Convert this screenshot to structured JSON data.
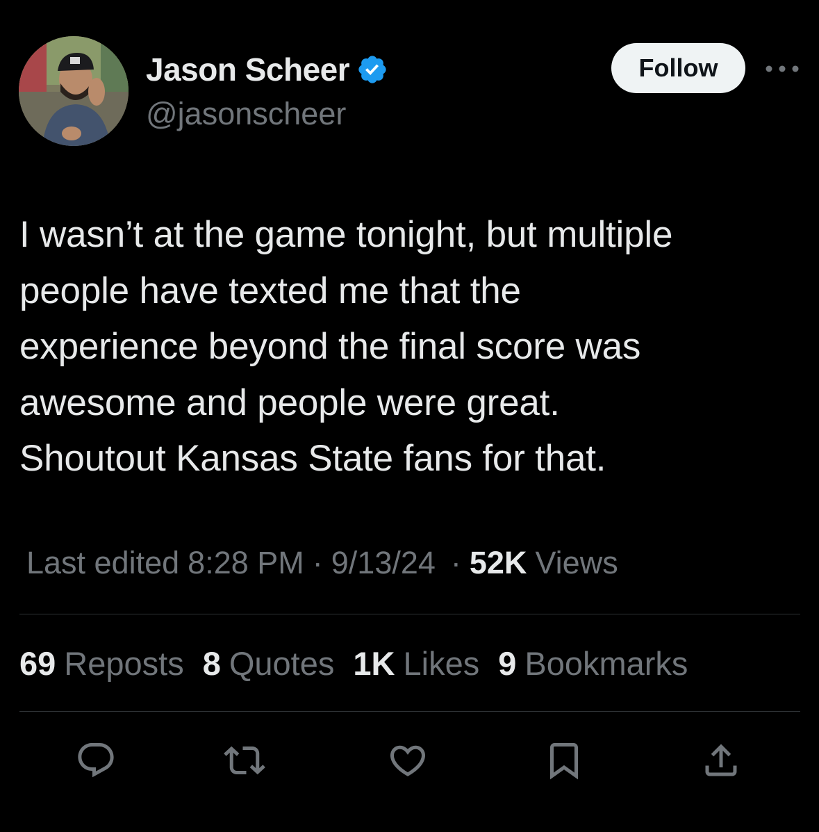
{
  "user": {
    "display_name": "Jason Scheer",
    "handle": "@jasonscheer",
    "verified": true,
    "avatar_icon": "profile-photo"
  },
  "header": {
    "follow_label": "Follow",
    "more_icon": "more-dots-icon"
  },
  "tweet": {
    "text": "I wasn’t at the game tonight, but multiple\npeople have texted me that the\nexperience beyond the final score was\nawesome and people were great.\nShoutout Kansas State fans for that."
  },
  "meta": {
    "edited_label": "Last edited",
    "time": "8:28 PM",
    "date": "9/13/24",
    "separator": "·",
    "views_count": "52K",
    "views_label": "Views"
  },
  "stats": [
    {
      "count": "69",
      "label": "Reposts"
    },
    {
      "count": "8",
      "label": "Quotes"
    },
    {
      "count": "1K",
      "label": "Likes"
    },
    {
      "count": "9",
      "label": "Bookmarks"
    }
  ],
  "actions": [
    {
      "icon": "reply-icon"
    },
    {
      "icon": "repost-icon"
    },
    {
      "icon": "like-icon"
    },
    {
      "icon": "bookmark-icon"
    },
    {
      "icon": "share-icon"
    }
  ],
  "colors": {
    "background": "#000000",
    "primary_text": "#e7e9ea",
    "secondary_text": "#71767b",
    "divider": "#2f3336",
    "verified_badge": "#1d9bf0",
    "follow_button_bg": "#eff3f4"
  }
}
